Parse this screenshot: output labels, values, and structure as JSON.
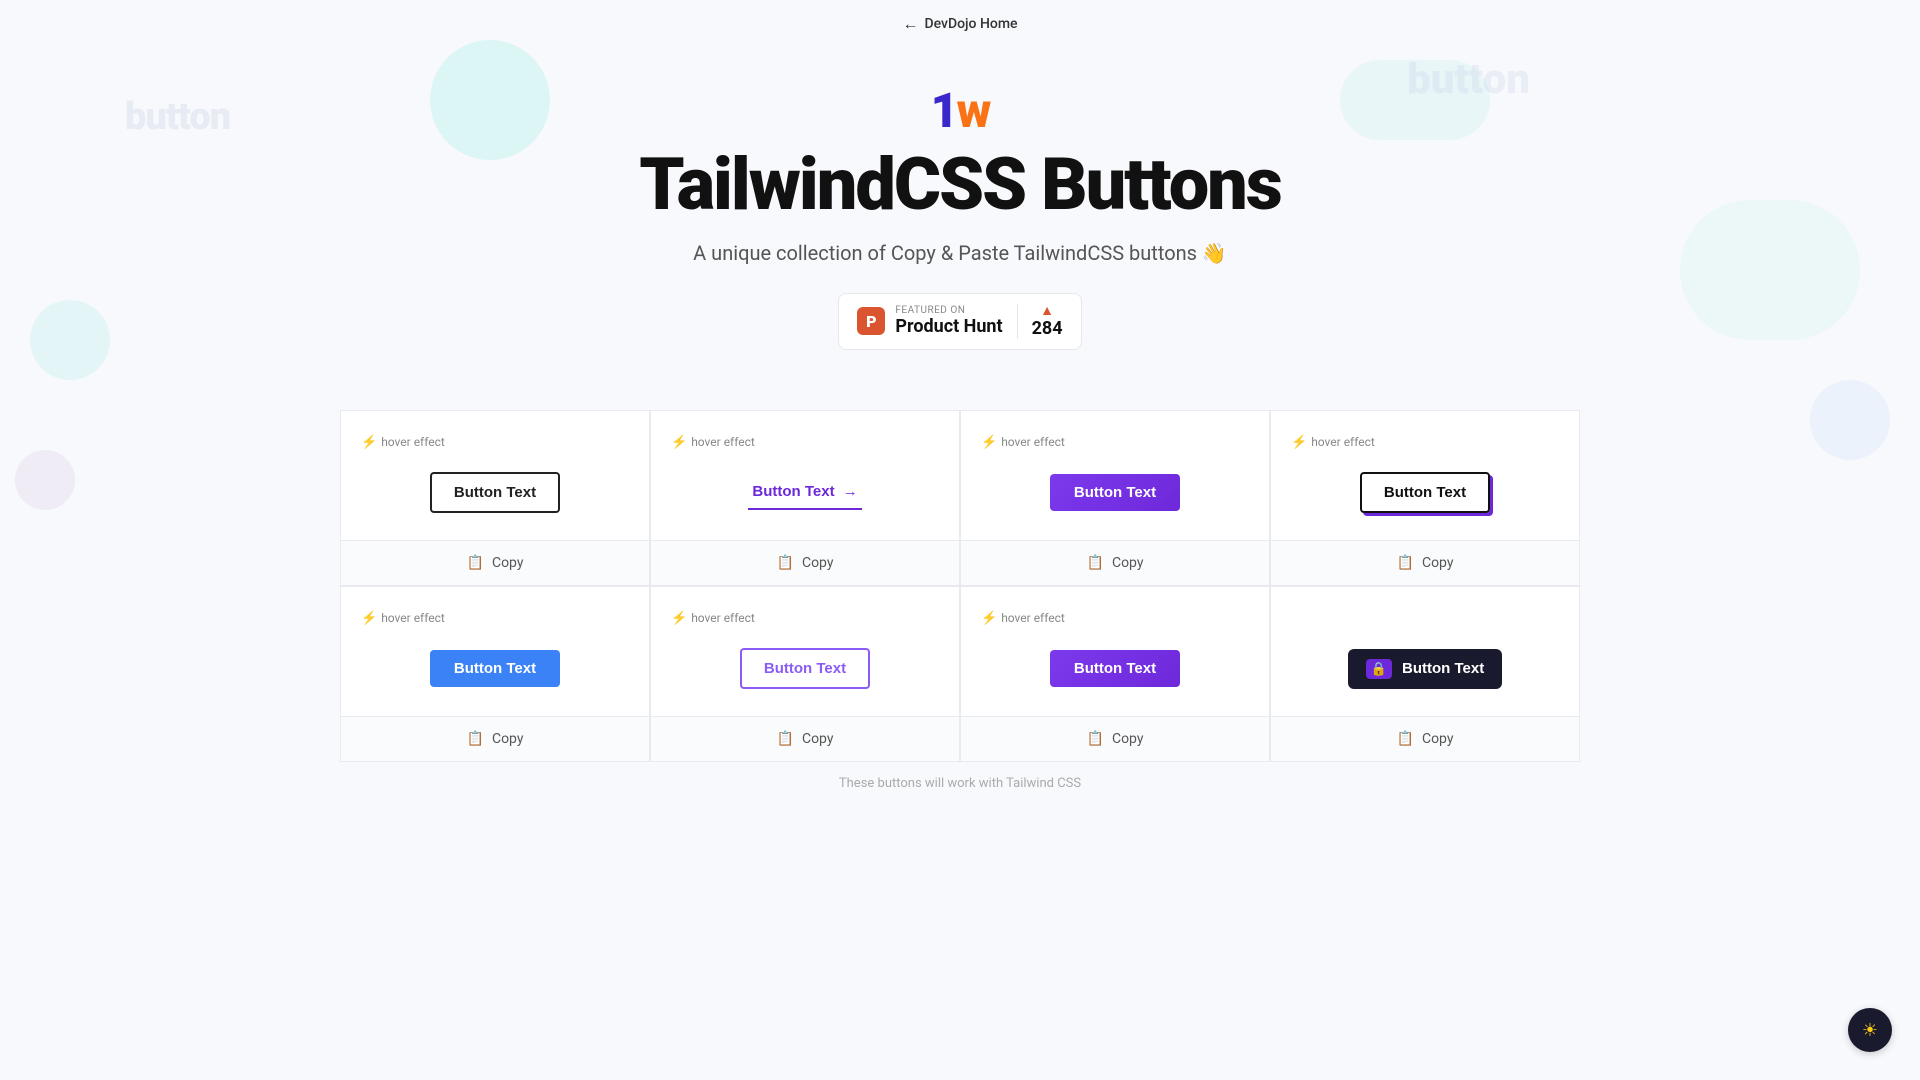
{
  "nav": {
    "back_label": "DevDojo Home"
  },
  "hero": {
    "logo_t": "1",
    "logo_w": "w",
    "title": "TailwindCSS Buttons",
    "subtitle": "A unique collection of Copy & Paste TailwindCSS buttons 👋",
    "ph": {
      "featured_label": "FEATURED ON",
      "name": "Product Hunt",
      "count": "284"
    }
  },
  "buttons_row1": [
    {
      "hover_label": "hover effect",
      "btn_text": "Button Text",
      "btn_type": "outline-dark",
      "copy_label": "Copy"
    },
    {
      "hover_label": "hover effect",
      "btn_text": "Button Text",
      "btn_type": "text-arrow",
      "copy_label": "Copy"
    },
    {
      "hover_label": "hover effect",
      "btn_text": "Button Text",
      "btn_type": "purple-filled",
      "copy_label": "Copy"
    },
    {
      "hover_label": "hover effect",
      "btn_text": "Button Text",
      "btn_type": "outline-shadow",
      "copy_label": "Copy"
    }
  ],
  "buttons_row2": [
    {
      "hover_label": "hover effect",
      "btn_text": "Button Text",
      "btn_type": "blue-filled",
      "copy_label": "Copy"
    },
    {
      "hover_label": "hover effect",
      "btn_text": "Button Text",
      "btn_type": "outline-purple-text",
      "copy_label": "Copy"
    },
    {
      "hover_label": "hover effect",
      "btn_text": "Button Text",
      "btn_type": "purple-filled-2",
      "copy_label": "Copy"
    },
    {
      "hover_label": "",
      "btn_text": "Button Text",
      "btn_type": "dark-icon",
      "copy_label": "Copy"
    }
  ],
  "dark_toggle": "☀",
  "bottom_hint": "These buttons will work with Tailwind CSS"
}
